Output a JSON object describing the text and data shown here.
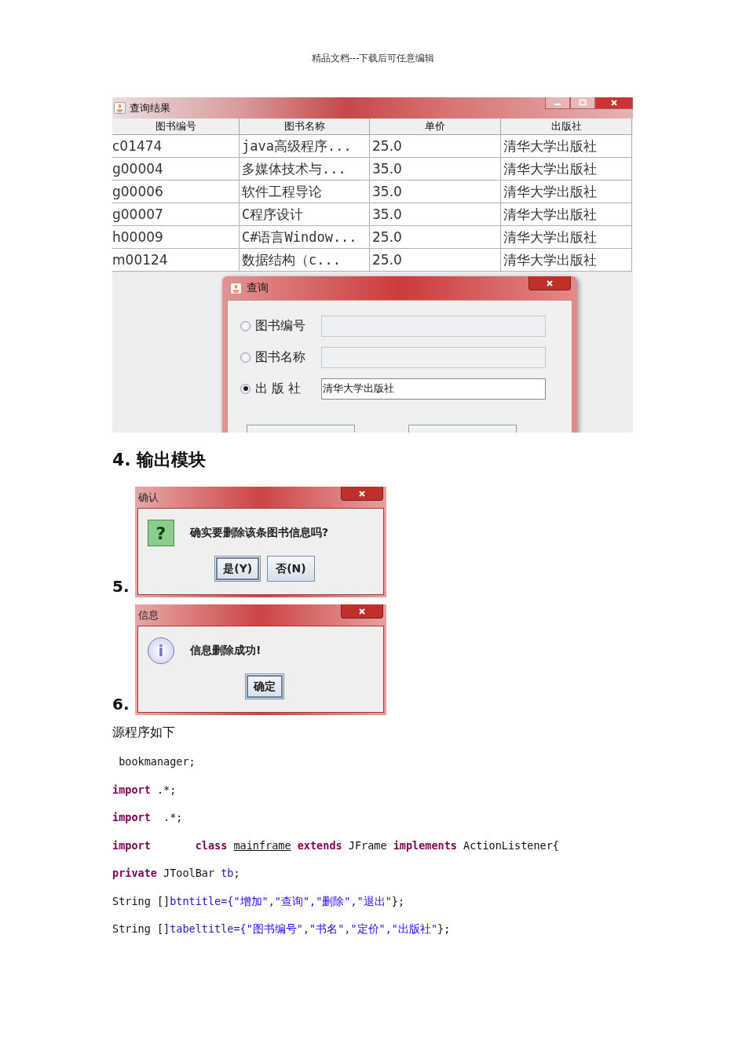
{
  "header": "精品文档---下载后可任意编辑",
  "results_window": {
    "title": "查询结果",
    "columns": [
      "图书编号",
      "图书名称",
      "单价",
      "出版社"
    ],
    "rows": [
      [
        "c01474",
        "java高级程序...",
        "25.0",
        "清华大学出版社"
      ],
      [
        "g00004",
        "多媒体技术与...",
        "35.0",
        "清华大学出版社"
      ],
      [
        "g00006",
        "软件工程导论",
        "35.0",
        "清华大学出版社"
      ],
      [
        "g00007",
        "C程序设计",
        "35.0",
        "清华大学出版社"
      ],
      [
        "h00009",
        "C#语言Window...",
        "25.0",
        "清华大学出版社"
      ],
      [
        "m00124",
        "数据结构（c...",
        "25.0",
        "清华大学出版社"
      ]
    ]
  },
  "query_dialog": {
    "title": "查询",
    "options": [
      {
        "label": "图书编号",
        "selected": false,
        "field_disabled": true
      },
      {
        "label": "图书名称",
        "selected": false,
        "field_disabled": true
      },
      {
        "label": "出 版 社",
        "selected": true,
        "field_disabled": false,
        "value": "清华大学出版社"
      }
    ]
  },
  "section_heading": "4. 输出模块",
  "dialogs": [
    {
      "number": "5.",
      "title": "确认",
      "icon": {
        "kind": "question",
        "glyph": "?"
      },
      "message": "确实要删除该条图书信息吗?",
      "buttons": [
        {
          "label": "是(Y)",
          "selected": true
        },
        {
          "label": "否(N)",
          "selected": false
        }
      ]
    },
    {
      "number": "6.",
      "title": "信息",
      "icon": {
        "kind": "info",
        "glyph": "i"
      },
      "message": "信息删除成功!",
      "buttons": [
        {
          "label": "确定",
          "selected": true
        }
      ]
    }
  ],
  "source_label": "源程序如下",
  "code_lines": [
    [
      {
        "text": " bookmanager;",
        "kind": "plain"
      }
    ],
    [
      {
        "text": "import",
        "kind": "keyword"
      },
      {
        "text": " .*;",
        "kind": "plain"
      }
    ],
    [
      {
        "text": "import",
        "kind": "keyword"
      },
      {
        "text": "  .*;",
        "kind": "plain"
      }
    ],
    [
      {
        "text": "import",
        "kind": "keyword"
      },
      {
        "text": "       class ",
        "kind": "keyword"
      },
      {
        "text": "mainframe",
        "kind": "underlined"
      },
      {
        "text": " extends",
        "kind": "keyword"
      },
      {
        "text": " JFrame ",
        "kind": "plain"
      },
      {
        "text": "implements",
        "kind": "keyword"
      },
      {
        "text": " ActionListener{",
        "kind": "plain"
      }
    ],
    [
      {
        "text": "private",
        "kind": "keyword"
      },
      {
        "text": " JToolBar ",
        "kind": "plain"
      },
      {
        "text": "tb",
        "kind": "ident"
      },
      {
        "text": ";",
        "kind": "plain"
      }
    ],
    [
      {
        "text": "String []",
        "kind": "plain"
      },
      {
        "text": "btntitle={",
        "kind": "ident"
      },
      {
        "text": "\"增加\",\"查询\",\"删除\",\"退出\"",
        "kind": "string"
      },
      {
        "text": "};",
        "kind": "plain"
      }
    ],
    [
      {
        "text": "String []",
        "kind": "plain"
      },
      {
        "text": "tabeltitle={",
        "kind": "ident"
      },
      {
        "text": "\"图书编号\",\"书名\",\"定价\",\"出版社\"",
        "kind": "string"
      },
      {
        "text": "};",
        "kind": "plain"
      }
    ]
  ]
}
